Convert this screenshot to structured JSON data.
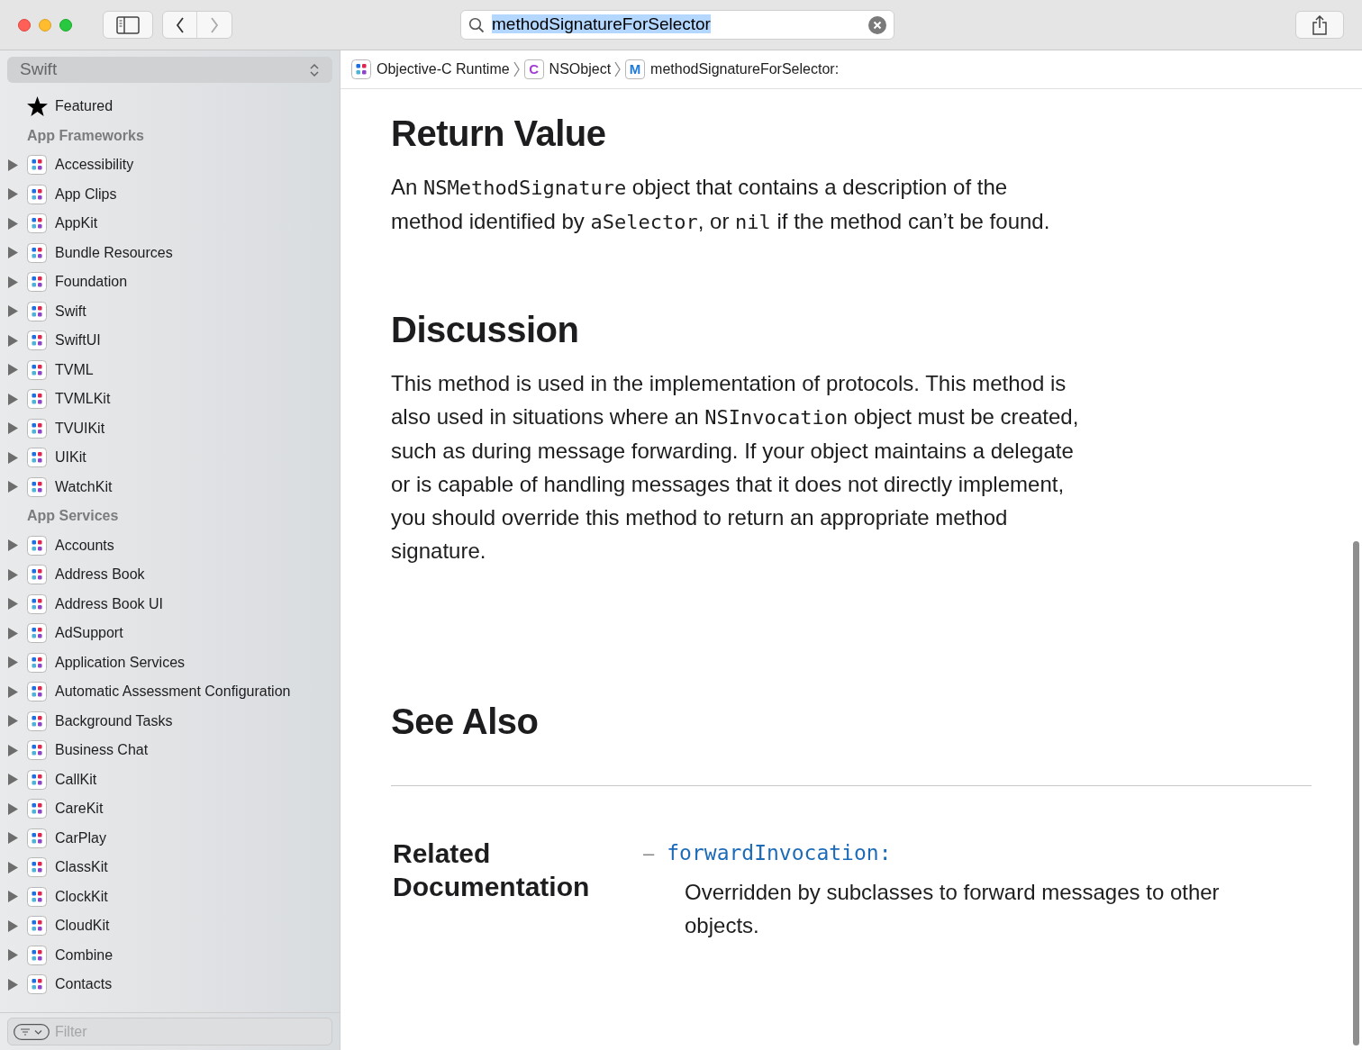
{
  "toolbar": {
    "search": {
      "value": "methodSignatureForSelector"
    }
  },
  "sidebar": {
    "language": "Swift",
    "featured": {
      "label": "Featured"
    },
    "sections": [
      {
        "title": "App Frameworks",
        "items": [
          "Accessibility",
          "App Clips",
          "AppKit",
          "Bundle Resources",
          "Foundation",
          "Swift",
          "SwiftUI",
          "TVML",
          "TVMLKit",
          "TVUIKit",
          "UIKit",
          "WatchKit"
        ]
      },
      {
        "title": "App Services",
        "items": [
          "Accounts",
          "Address Book",
          "Address Book UI",
          "AdSupport",
          "Application Services",
          "Automatic Assessment Configuration",
          "Background Tasks",
          "Business Chat",
          "CallKit",
          "CareKit",
          "CarPlay",
          "ClassKit",
          "ClockKit",
          "CloudKit",
          "Combine",
          "Contacts"
        ]
      }
    ],
    "filter": {
      "placeholder": "Filter"
    }
  },
  "breadcrumb": [
    {
      "kind": "framework",
      "label": "Objective-C Runtime"
    },
    {
      "kind": "class",
      "badge": "C",
      "label": "NSObject"
    },
    {
      "kind": "method",
      "badge": "M",
      "label": "methodSignatureForSelector:"
    }
  ],
  "content": {
    "sections": [
      {
        "heading": "Return Value",
        "paragraph": [
          {
            "kind": "text",
            "text": "An "
          },
          {
            "kind": "code",
            "text": "NSMethodSignature"
          },
          {
            "kind": "text",
            "text": " object that contains a description of the method identified by "
          },
          {
            "kind": "code",
            "text": "aSelector"
          },
          {
            "kind": "text",
            "text": ", or "
          },
          {
            "kind": "code",
            "text": "nil"
          },
          {
            "kind": "text",
            "text": " if the method can’t be found."
          }
        ]
      },
      {
        "heading": "Discussion",
        "paragraph": [
          {
            "kind": "text",
            "text": "This method is used in the implementation of protocols. This method is also used in situations where an "
          },
          {
            "kind": "code",
            "text": "NSInvocation"
          },
          {
            "kind": "text",
            "text": " object must be created, such as during message forwarding. If your object maintains a delegate or is capable of handling messages that it does not directly implement, you should override this method to return an appropriate method signature."
          }
        ]
      }
    ],
    "see_also": {
      "heading": "See Also",
      "group": "Related Documentation",
      "links": [
        {
          "dash": "–",
          "symbol": "forwardInvocation:",
          "summary": "Overridden by subclasses to forward messages to other objects."
        }
      ]
    }
  }
}
